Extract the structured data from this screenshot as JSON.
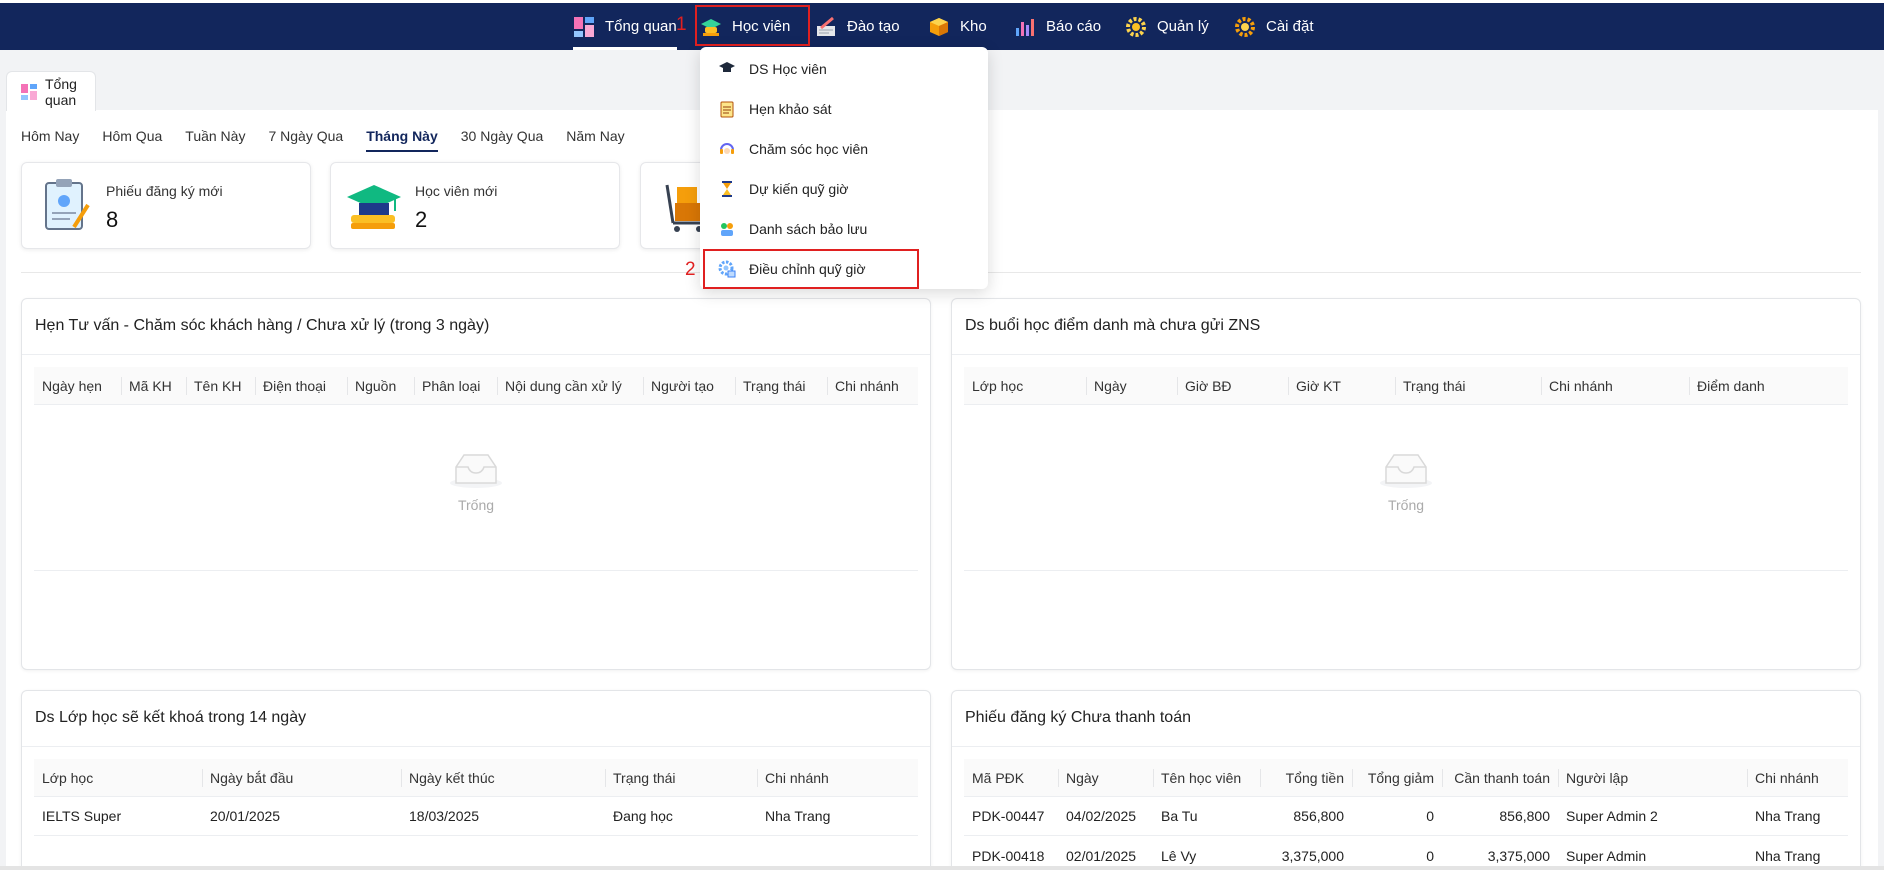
{
  "nav": {
    "items": [
      {
        "label": "Tổng quan",
        "icon": "dashboard-icon"
      },
      {
        "label": "Học viên",
        "icon": "graduation-cap-icon"
      },
      {
        "label": "Đào tạo",
        "icon": "training-icon"
      },
      {
        "label": "Kho",
        "icon": "box-icon"
      },
      {
        "label": "Báo cáo",
        "icon": "report-chart-icon"
      },
      {
        "label": "Quản lý",
        "icon": "manage-gear-icon"
      },
      {
        "label": "Cài đặt",
        "icon": "settings-gear-icon"
      }
    ],
    "step1": "1",
    "step2": "2"
  },
  "dropdown": {
    "items": [
      {
        "label": "DS Học viên",
        "icon": "mortarboard-icon"
      },
      {
        "label": "Hẹn khảo sát",
        "icon": "clipboard-icon"
      },
      {
        "label": "Chăm sóc học viên",
        "icon": "headset-icon"
      },
      {
        "label": "Dự kiến quỹ giờ",
        "icon": "hourglass-icon"
      },
      {
        "label": "Danh sách bảo lưu",
        "icon": "reserve-list-icon"
      },
      {
        "label": "Điều chỉnh quỹ giờ",
        "icon": "adjust-gear-icon"
      }
    ]
  },
  "page_tab": {
    "label": "Tổng quan"
  },
  "ranges": [
    "Hôm Nay",
    "Hôm Qua",
    "Tuần Này",
    "7 Ngày Qua",
    "Tháng Này",
    "30 Ngày Qua",
    "Năm Nay"
  ],
  "active_range": "Tháng Này",
  "stats": [
    {
      "label": "Phiếu đăng ký mới",
      "value": "8"
    },
    {
      "label": "Học viên mới",
      "value": "2"
    }
  ],
  "cards": {
    "appointments": {
      "title": "Hẹn Tư vấn - Chăm sóc khách hàng / Chưa xử lý (trong 3 ngày)",
      "columns": [
        "Ngày hẹn",
        "Mã KH",
        "Tên KH",
        "Điện thoại",
        "Nguồn",
        "Phân loại",
        "Nội dung cần xử lý",
        "Người tạo",
        "Trạng thái",
        "Chi nhánh"
      ],
      "empty": "Trống"
    },
    "attendance": {
      "title": "Ds buổi học điểm danh mà chưa gửi ZNS",
      "columns": [
        "Lớp học",
        "Ngày",
        "Giờ BĐ",
        "Giờ KT",
        "Trạng thái",
        "Chi nhánh",
        "Điểm danh"
      ],
      "empty": "Trống"
    },
    "closing": {
      "title": "Ds Lớp học sẽ kết khoá trong 14 ngày",
      "columns": [
        "Lớp học",
        "Ngày bắt đầu",
        "Ngày kết thúc",
        "Trạng thái",
        "Chi nhánh"
      ],
      "rows": [
        [
          "IELTS Super",
          "20/01/2025",
          "18/03/2025",
          "Đang học",
          "Nha Trang"
        ]
      ]
    },
    "unpaid": {
      "title": "Phiếu đăng ký Chưa thanh toán",
      "columns": [
        "Mã PĐK",
        "Ngày",
        "Tên học viên",
        "Tổng tiền",
        "Tổng giảm",
        "Cần thanh toán",
        "Người lập",
        "Chi nhánh"
      ],
      "rows": [
        [
          "PDK-00447",
          "04/02/2025",
          "Ba Tu",
          "856,800",
          "0",
          "856,800",
          "Super Admin 2",
          "Nha Trang"
        ],
        [
          "PDK-00418",
          "02/01/2025",
          "Lê Vy",
          "3,375,000",
          "0",
          "3,375,000",
          "Super Admin",
          "Nha Trang"
        ]
      ]
    }
  },
  "colors": {
    "navbar": "#12265c",
    "highlight": "#e02020",
    "accent": "#12265c"
  }
}
